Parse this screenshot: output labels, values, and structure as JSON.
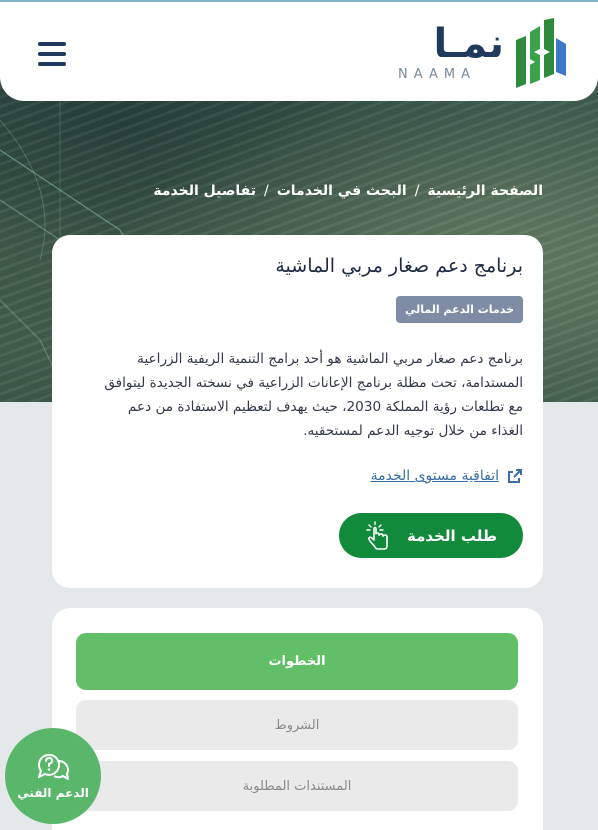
{
  "header": {
    "logo_ar": "نمـا",
    "logo_en": "NAAMA"
  },
  "breadcrumb": {
    "home": "الصفحة الرئيسية",
    "search": "البحث في الخدمات",
    "current": "تفاصيل الخدمة",
    "separator": "/"
  },
  "service": {
    "title": "برنامج دعم صغار مربي الماشية",
    "badge": "خدمات الدعم المالي",
    "description": "برنامج دعم صغار مربي الماشية هو أحد برامج التنمية الريفية الزراعية المستدامة، تحت مظلة برنامج الإعانات الزراعية في نسخته الجديدة ليتوافق مع تطلعات رؤية المملكة 2030، حيث يهدف لتعظيم الاستفادة من دعم الغذاء من خلال توجيه الدعم لمستحقيه.",
    "sla_link": "اتفاقية مستوى الخدمة",
    "request_button": "طلب الخدمة"
  },
  "tabs": [
    {
      "label": "الخطوات",
      "active": true
    },
    {
      "label": "الشروط",
      "active": false
    },
    {
      "label": "المستندات المطلوبة",
      "active": false
    }
  ],
  "support": {
    "label": "الدعم الفني"
  },
  "colors": {
    "brand_navy": "#1f3a5c",
    "brand_green": "#118a3c",
    "active_tab": "#62bf68",
    "badge": "#7e8da5",
    "link": "#3a6ea5",
    "support": "#5ab66a"
  }
}
